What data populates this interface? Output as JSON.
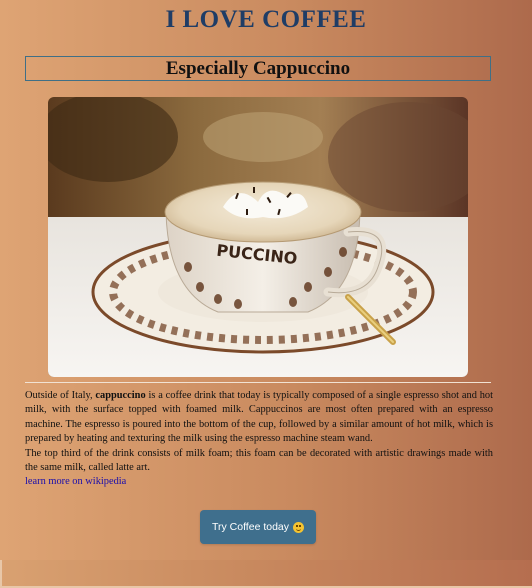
{
  "header": {
    "title": "I LOVE COFFEE",
    "subtitle": "Especially Cappuccino"
  },
  "image": {
    "alt": "cappuccino",
    "cup_text": "PUCCINO"
  },
  "content": {
    "p1_before_bold": "Outside of Italy, ",
    "p1_bold": "cappuccino",
    "p1_after_bold": " is a coffee drink that today is typically composed of a single espresso shot and hot milk, with the surface topped with foamed milk. Cappuccinos are most often prepared with an espresso machine. The espresso is poured into the bottom of the cup, followed by a similar amount of hot milk, which is prepared by heating and texturing the milk using the espresso machine steam wand.",
    "p2": "The top third of the drink consists of milk foam; this foam can be decorated with artistic drawings made with the same milk, called latte art.",
    "link_text": "learn more on wikipedia"
  },
  "cta": {
    "label": "Try Coffee today",
    "icon": "smiley-icon"
  }
}
